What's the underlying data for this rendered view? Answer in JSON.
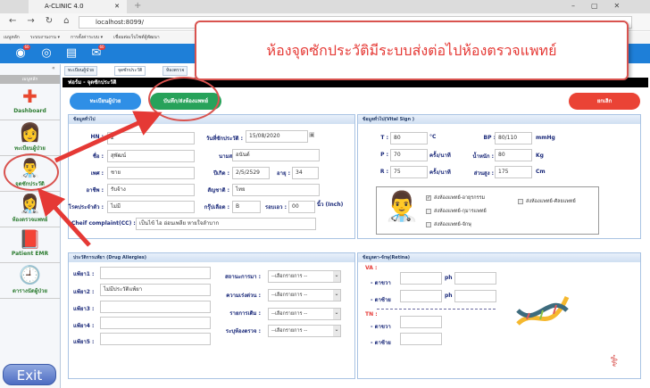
{
  "browser": {
    "tab_title": "A-CLINIC 4.0",
    "url": "localhost:8099/",
    "bookmarks": [
      "เมนูหลัก",
      "ระบบงานงาน ▾",
      "การตั้งค่าระบบ ▾",
      "เชื่อมต่อเว็บไซต์ผู้พัฒนา"
    ]
  },
  "header": {
    "badges": [
      "60",
      "60"
    ]
  },
  "sidebar": {
    "title": "เมนูหลัก",
    "items": [
      {
        "label": "Dashboard",
        "icon": "✚"
      },
      {
        "label": "ทะเบียนผู้ป่วย",
        "icon": "👩"
      },
      {
        "label": "จุดซักประวัติ",
        "icon": "👨‍⚕️"
      },
      {
        "label": "ห้องตรวจแพทย์",
        "icon": "👩‍⚕️"
      },
      {
        "label": "Patient EMR",
        "icon": "📕"
      },
      {
        "label": "ตารางนัดผู้ป่วย",
        "icon": "🕘"
      }
    ],
    "exit": "Exit"
  },
  "tabs": [
    "ทะเบียนผู้ป่วย",
    "จุดซักประวัติ",
    "ห้องตรวจ"
  ],
  "form_title": "ฟอร์ม - จุดซักประวัติ",
  "buttons": {
    "register": "ทะเบียนผู้ป่วย",
    "save": "บันทึก/ส่งห้องแพทย์",
    "cancel": "ยกเลิก"
  },
  "general": {
    "title": "ข้อมูลทั่วไป",
    "hn_label": "HN :",
    "hn": "2",
    "date_label": "วันที่ซักประวัติ :",
    "date": "15/08/2020",
    "name_label": "ชื่อ :",
    "name": "สุพัฒน์",
    "surname_label": "นามสกุล :",
    "surname": "อนันต์",
    "sex_label": "เพศ :",
    "sex": "ชาย",
    "dob_label": "ปีเกิด :",
    "dob": "2/5/2529",
    "age_label": "อายุ :",
    "age": "34",
    "job_label": "อาชีพ :",
    "job": "รับจ้าง",
    "nation_label": "สัญชาติ :",
    "nation": "ไทย",
    "disease_label": "โรคประจำตัว :",
    "disease": "ไม่มี",
    "blood_label": "กรุ๊ปเลือด :",
    "blood": "B",
    "waist_label": "รอบเอว :",
    "waist": "00",
    "waist_unit": "นิ้ว (Inch)",
    "cc_label": "Cheif complaint(CC) :",
    "cc": "เป็นไข้ ไอ อ่อนเพลีย หายใจลำบาก"
  },
  "vital": {
    "title": "ข้อมูลทั่วไป(Vital Sign )",
    "t_label": "T :",
    "t": "80",
    "t_unit": "°C",
    "bp_label": "BP :",
    "bp": "80/110",
    "bp_unit": "mmHg",
    "p_label": "P :",
    "p": "70",
    "p_unit": "ครั้ง/นาที",
    "w_label": "น้ำหนัก :",
    "w": "80",
    "w_unit": "Kg",
    "r_label": "R :",
    "r": "75",
    "r_unit": "ครั้ง/นาที",
    "h_label": "ส่วนสูง :",
    "h": "175",
    "h_unit": "Cm",
    "checks": [
      {
        "label": "ส่งห้องแพทย์-อายุรกรรม",
        "checked": true
      },
      {
        "label": "ส่งห้องแพทย์-กุมารแพทย์",
        "checked": false
      },
      {
        "label": "ส่งห้องแพทย์-จักษุ",
        "checked": false
      },
      {
        "label": "ส่งห้องแพทย์-ศัลยแพทย์",
        "checked": false
      }
    ]
  },
  "drug": {
    "title": "ประวัติการแพ้ยา (Drug Allergies)",
    "labels": [
      "แพ้ยา1 :",
      "แพ้ยา2 :",
      "แพ้ยา3 :",
      "แพ้ยา4 :",
      "แพ้ยา5 :"
    ],
    "values": [
      "",
      "ไม่มีประวัติแพ้ยา",
      "",
      "",
      ""
    ],
    "selects": [
      {
        "label": "สถานะการมา :",
        "value": "--เลือกรายการ --"
      },
      {
        "label": "ความเร่งด่วน :",
        "value": "--เลือกรายการ --"
      },
      {
        "label": "รายการเดิม :",
        "value": "--เลือกรายการ --"
      },
      {
        "label": "ระบุห้องตรวจ :",
        "value": "--เลือกรายการ --"
      }
    ]
  },
  "retina": {
    "title": "ข้อมูลตา-จักษุ(Retina)",
    "va": "VA :",
    "tn": "TN :",
    "right": "- ตาขวา",
    "left": "- ตาซ้าย",
    "ph": "ph"
  },
  "callout": "ห้องจุดซักประวัติมีระบบส่งต่อไปห้องตรวจแพทย์"
}
